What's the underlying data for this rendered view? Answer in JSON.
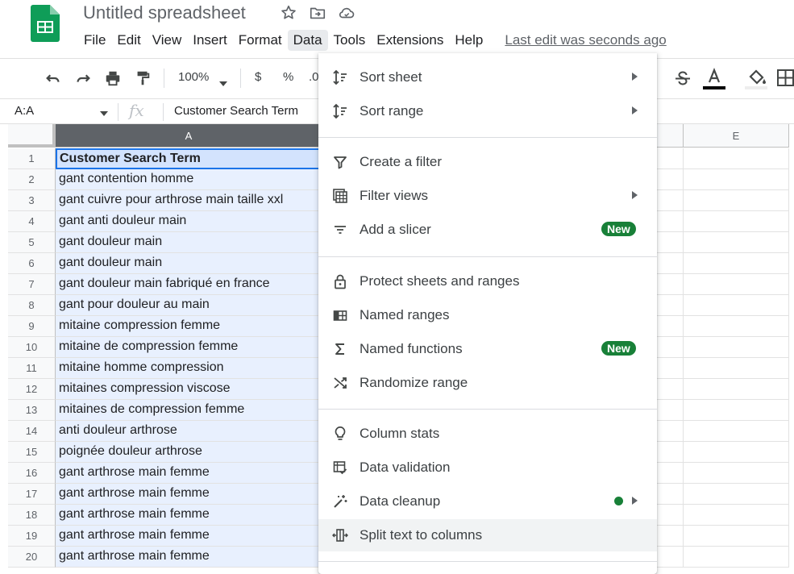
{
  "document": {
    "title": "Untitled spreadsheet",
    "last_edit": "Last edit was seconds ago"
  },
  "menubar": {
    "items": [
      "File",
      "Edit",
      "View",
      "Insert",
      "Format",
      "Data",
      "Tools",
      "Extensions",
      "Help"
    ],
    "active": "Data"
  },
  "toolbar": {
    "zoom": "100%",
    "currency_label": "$",
    "percent_label": "%",
    "decimal_label": ".0"
  },
  "formula_bar": {
    "name_box": "A:A",
    "fx_label": "fx",
    "value": "Customer Search Term"
  },
  "grid": {
    "columns": [
      "A",
      "E"
    ],
    "rows": [
      {
        "num": "1",
        "value": "Customer Search Term"
      },
      {
        "num": "2",
        "value": "gant contention homme"
      },
      {
        "num": "3",
        "value": "gant cuivre pour arthrose main taille xxl"
      },
      {
        "num": "4",
        "value": "gant anti douleur main"
      },
      {
        "num": "5",
        "value": "gant douleur main"
      },
      {
        "num": "6",
        "value": "gant douleur main"
      },
      {
        "num": "7",
        "value": "gant douleur main fabriqué en france"
      },
      {
        "num": "8",
        "value": "gant pour douleur au main"
      },
      {
        "num": "9",
        "value": "mitaine compression femme"
      },
      {
        "num": "10",
        "value": "mitaine de compression femme"
      },
      {
        "num": "11",
        "value": "mitaine homme compression"
      },
      {
        "num": "12",
        "value": "mitaines compression viscose"
      },
      {
        "num": "13",
        "value": "mitaines de compression femme"
      },
      {
        "num": "14",
        "value": "anti douleur arthrose"
      },
      {
        "num": "15",
        "value": "poignée douleur arthrose"
      },
      {
        "num": "16",
        "value": "gant arthrose main femme"
      },
      {
        "num": "17",
        "value": "gant arthrose main femme"
      },
      {
        "num": "18",
        "value": "gant arthrose main femme"
      },
      {
        "num": "19",
        "value": "gant arthrose main femme"
      },
      {
        "num": "20",
        "value": "gant arthrose main femme"
      }
    ]
  },
  "data_menu": {
    "sort_sheet": "Sort sheet",
    "sort_range": "Sort range",
    "create_filter": "Create a filter",
    "filter_views": "Filter views",
    "add_slicer": "Add a slicer",
    "protect": "Protect sheets and ranges",
    "named_ranges": "Named ranges",
    "named_functions": "Named functions",
    "randomize": "Randomize range",
    "column_stats": "Column stats",
    "data_validation": "Data validation",
    "data_cleanup": "Data cleanup",
    "split_text": "Split text to columns",
    "new_badge": "New"
  },
  "colors": {
    "brand_green": "#188038",
    "selection_blue": "#1a73e8",
    "selected_fill": "#e8f0fe",
    "logo_green": "#0f9d58"
  }
}
